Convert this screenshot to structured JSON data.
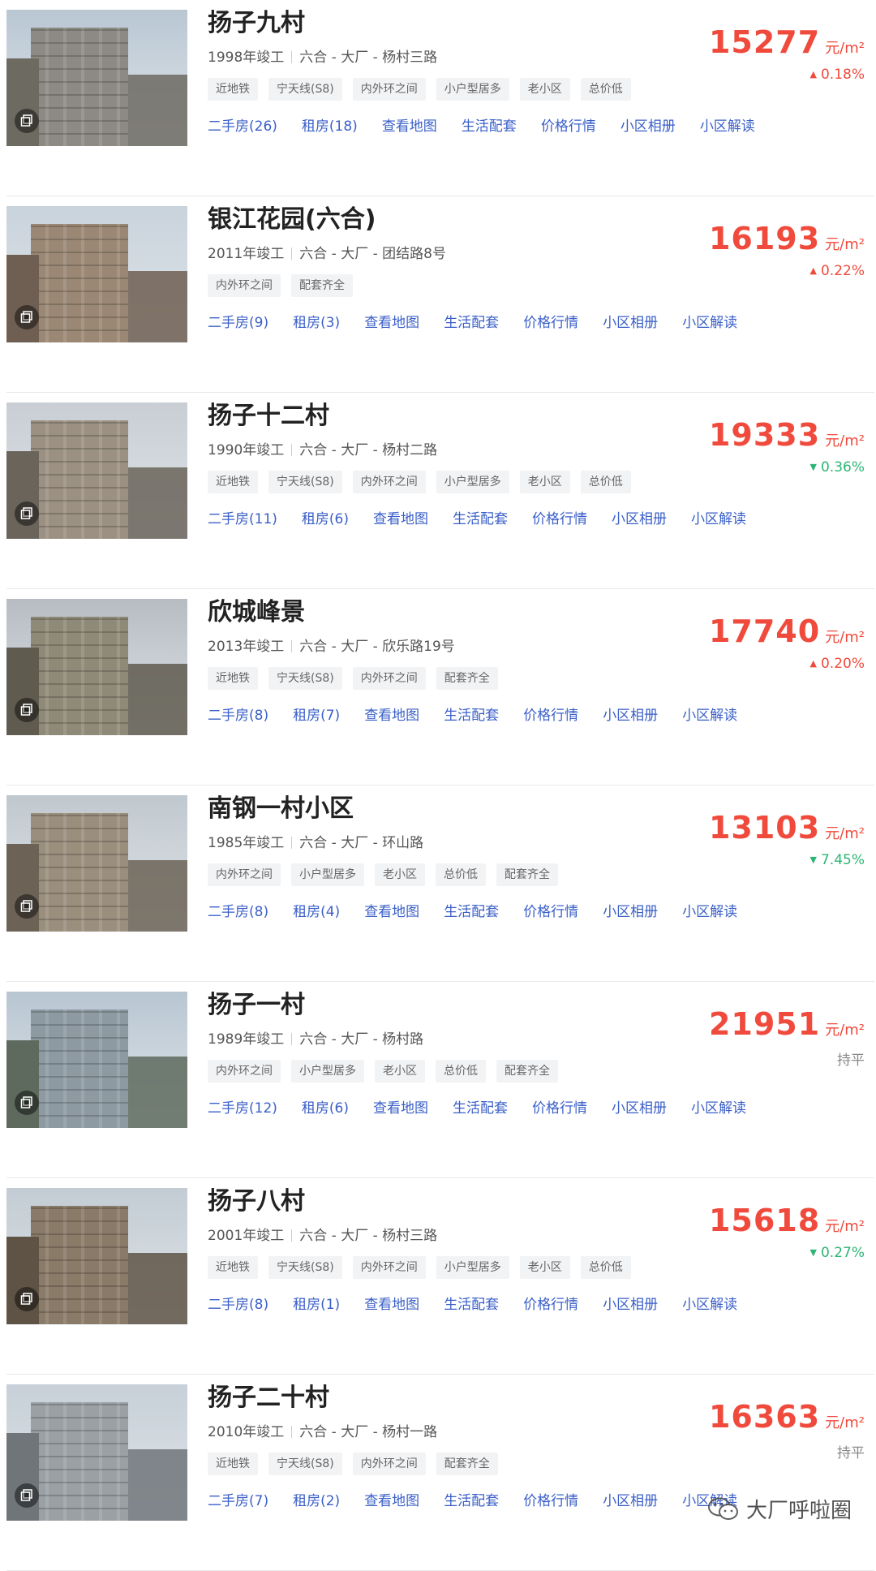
{
  "colors": {
    "price": "#f04a3c",
    "up": "#f04a3c",
    "down": "#2bb673",
    "flat": "#888888",
    "link": "#3a5fc8"
  },
  "price_unit": "元/m²",
  "communities": [
    {
      "name": "扬子九村",
      "year": "1998年竣工",
      "location": "六合 - 大厂 - 杨村三路",
      "tags": [
        "近地铁",
        "宁天线(S8)",
        "内外环之间",
        "小户型居多",
        "老小区",
        "总价低"
      ],
      "links": [
        "二手房(26)",
        "租房(18)",
        "查看地图",
        "生活配套",
        "价格行情",
        "小区相册",
        "小区解读"
      ],
      "price": "15277",
      "change": "0.18%",
      "trend": "up"
    },
    {
      "name": "银江花园(六合)",
      "year": "2011年竣工",
      "location": "六合 - 大厂 - 团结路8号",
      "tags": [
        "内外环之间",
        "配套齐全"
      ],
      "links": [
        "二手房(9)",
        "租房(3)",
        "查看地图",
        "生活配套",
        "价格行情",
        "小区相册",
        "小区解读"
      ],
      "price": "16193",
      "change": "0.22%",
      "trend": "up"
    },
    {
      "name": "扬子十二村",
      "year": "1990年竣工",
      "location": "六合 - 大厂 - 杨村二路",
      "tags": [
        "近地铁",
        "宁天线(S8)",
        "内外环之间",
        "小户型居多",
        "老小区",
        "总价低"
      ],
      "links": [
        "二手房(11)",
        "租房(6)",
        "查看地图",
        "生活配套",
        "价格行情",
        "小区相册",
        "小区解读"
      ],
      "price": "19333",
      "change": "0.36%",
      "trend": "down"
    },
    {
      "name": "欣城峰景",
      "year": "2013年竣工",
      "location": "六合 - 大厂 - 欣乐路19号",
      "tags": [
        "近地铁",
        "宁天线(S8)",
        "内外环之间",
        "配套齐全"
      ],
      "links": [
        "二手房(8)",
        "租房(7)",
        "查看地图",
        "生活配套",
        "价格行情",
        "小区相册",
        "小区解读"
      ],
      "price": "17740",
      "change": "0.20%",
      "trend": "up"
    },
    {
      "name": "南钢一村小区",
      "year": "1985年竣工",
      "location": "六合 - 大厂 - 环山路",
      "tags": [
        "内外环之间",
        "小户型居多",
        "老小区",
        "总价低",
        "配套齐全"
      ],
      "links": [
        "二手房(8)",
        "租房(4)",
        "查看地图",
        "生活配套",
        "价格行情",
        "小区相册",
        "小区解读"
      ],
      "price": "13103",
      "change": "7.45%",
      "trend": "down"
    },
    {
      "name": "扬子一村",
      "year": "1989年竣工",
      "location": "六合 - 大厂 - 杨村路",
      "tags": [
        "内外环之间",
        "小户型居多",
        "老小区",
        "总价低",
        "配套齐全"
      ],
      "links": [
        "二手房(12)",
        "租房(6)",
        "查看地图",
        "生活配套",
        "价格行情",
        "小区相册",
        "小区解读"
      ],
      "price": "21951",
      "change": "持平",
      "trend": "flat"
    },
    {
      "name": "扬子八村",
      "year": "2001年竣工",
      "location": "六合 - 大厂 - 杨村三路",
      "tags": [
        "近地铁",
        "宁天线(S8)",
        "内外环之间",
        "小户型居多",
        "老小区",
        "总价低"
      ],
      "links": [
        "二手房(8)",
        "租房(1)",
        "查看地图",
        "生活配套",
        "价格行情",
        "小区相册",
        "小区解读"
      ],
      "price": "15618",
      "change": "0.27%",
      "trend": "down"
    },
    {
      "name": "扬子二十村",
      "year": "2010年竣工",
      "location": "六合 - 大厂 - 杨村一路",
      "tags": [
        "近地铁",
        "宁天线(S8)",
        "内外环之间",
        "配套齐全"
      ],
      "links": [
        "二手房(7)",
        "租房(2)",
        "查看地图",
        "生活配套",
        "价格行情",
        "小区相册",
        "小区解读"
      ],
      "price": "16363",
      "change": "持平",
      "trend": "flat"
    }
  ],
  "watermark": {
    "text": "大厂呼啦圈",
    "icon": "wechat-icon"
  }
}
